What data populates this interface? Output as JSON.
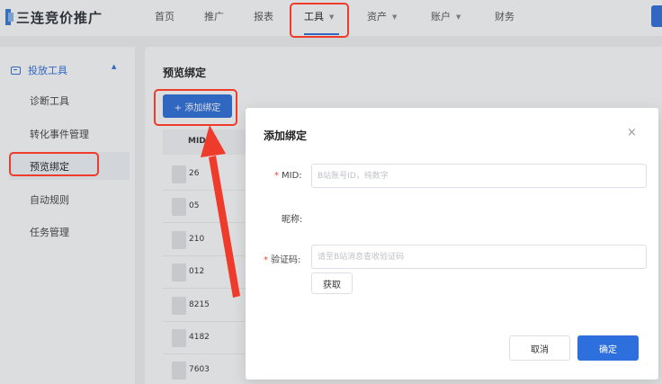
{
  "app": {
    "title": "三连竞价推广"
  },
  "nav": {
    "items": [
      {
        "label": "首页",
        "dropdown": false
      },
      {
        "label": "推广",
        "dropdown": false
      },
      {
        "label": "报表",
        "dropdown": false
      },
      {
        "label": "工具",
        "dropdown": true,
        "active": true
      },
      {
        "label": "资产",
        "dropdown": true
      },
      {
        "label": "账户",
        "dropdown": true
      },
      {
        "label": "财务",
        "dropdown": false
      }
    ],
    "caret": "▼"
  },
  "sidebar": {
    "group_label": "投放工具",
    "group_caret": "▲",
    "items": [
      {
        "label": "诊断工具"
      },
      {
        "label": "转化事件管理"
      },
      {
        "label": "预览绑定",
        "selected": true
      },
      {
        "label": "自动规则"
      },
      {
        "label": "任务管理"
      }
    ]
  },
  "page": {
    "title": "预览绑定",
    "add_button": "+ 添加绑定",
    "table_header": "MID",
    "rows": [
      "26",
      "05",
      "210",
      "012",
      "8215",
      "4182",
      "7603"
    ]
  },
  "dialog": {
    "title": "添加绑定",
    "close": "×",
    "mid_label": "MID:",
    "mid_placeholder": "B站账号ID，纯数字",
    "nickname_label": "昵称:",
    "code_label": "验证码:",
    "code_placeholder": "请至B站消息查收验证码",
    "get_button": "获取",
    "cancel_button": "取消",
    "ok_button": "确定",
    "required_mark": "*"
  },
  "colors": {
    "accent": "#2d6fdc",
    "highlight": "#ef3b2c",
    "required": "#e8483c"
  }
}
